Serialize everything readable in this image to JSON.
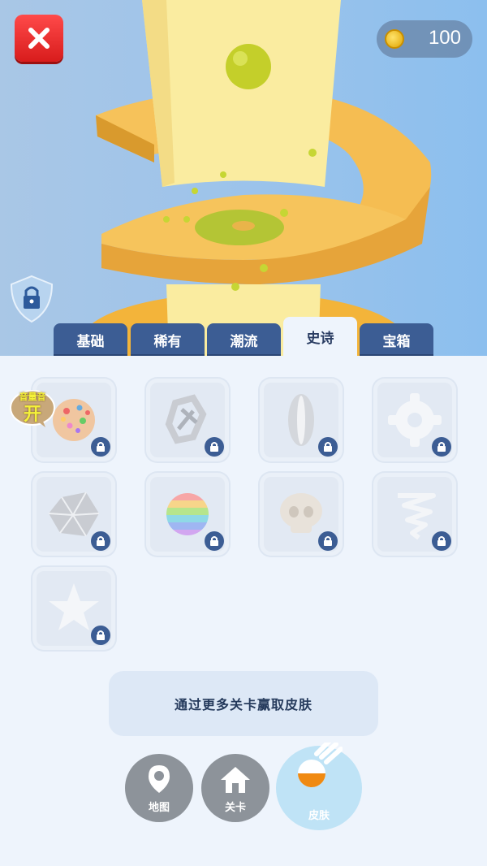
{
  "hud": {
    "coins": "100"
  },
  "tabs": [
    {
      "label": "基础"
    },
    {
      "label": "稀有"
    },
    {
      "label": "潮流"
    },
    {
      "label": "史诗"
    },
    {
      "label": "宝箱"
    }
  ],
  "active_tab": "史诗",
  "items": [
    {
      "icon": "sprinkle-ball-icon",
      "locked": true
    },
    {
      "icon": "knot-icon",
      "locked": true
    },
    {
      "icon": "capsule-icon",
      "locked": true
    },
    {
      "icon": "gear-icon",
      "locked": true
    },
    {
      "icon": "polyhedron-icon",
      "locked": true
    },
    {
      "icon": "rainbow-ball-icon",
      "locked": true
    },
    {
      "icon": "skull-icon",
      "locked": true
    },
    {
      "icon": "spiral-icon",
      "locked": true
    },
    {
      "icon": "star-icon",
      "locked": true
    }
  ],
  "sound_badge": {
    "top": "音量音",
    "main": "开"
  },
  "info": {
    "message": "通过更多关卡赢取皮肤"
  },
  "bottom_nav": [
    {
      "label": "地图"
    },
    {
      "label": "关卡"
    },
    {
      "label": "皮肤"
    }
  ],
  "colors": {
    "tab": "#3c5d94",
    "close": "#e52a2a",
    "accent": "#f2b84a"
  }
}
